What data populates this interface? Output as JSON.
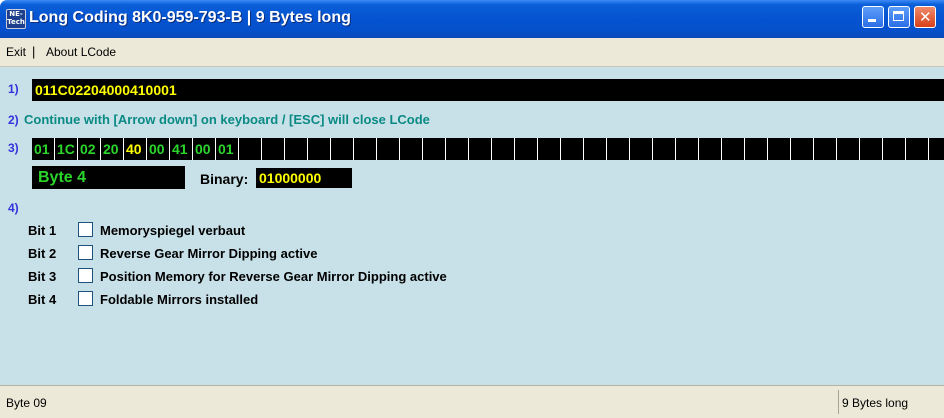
{
  "window": {
    "title": "Long Coding  8K0-959-793-B  |  9 Bytes long",
    "icon_text": [
      "NE-",
      "Tech"
    ]
  },
  "menu": {
    "items": [
      "Exit",
      "About LCode"
    ],
    "separator": "|"
  },
  "steps": {
    "s1": "1)",
    "s2": "2)",
    "s3": "3)",
    "s4": "4)"
  },
  "coding": {
    "value": "011C02204000410001"
  },
  "hint": "Continue with [Arrow down] on keyboard / [ESC] will close LCode",
  "bytes": {
    "values": [
      "01",
      "1C",
      "02",
      "20",
      "40",
      "00",
      "41",
      "00",
      "01"
    ],
    "selected_index": 4,
    "empty_cells": 31
  },
  "selected_byte": {
    "label": "Byte 4",
    "binary_label": "Binary:",
    "binary_value": "01000000"
  },
  "bits": [
    {
      "label": "Bit 1",
      "checked": false,
      "description": "Memoryspiegel verbaut"
    },
    {
      "label": "Bit 2",
      "checked": false,
      "description": "Reverse Gear Mirror Dipping active"
    },
    {
      "label": "Bit 3",
      "checked": false,
      "description": "Position Memory for Reverse Gear Mirror Dipping active"
    },
    {
      "label": "Bit 4",
      "checked": false,
      "description": "Foldable Mirrors installed"
    }
  ],
  "statusbar": {
    "left": "Byte 09",
    "right": "9 Bytes long"
  },
  "colors": {
    "title_blue": "#0553d1",
    "client_bg": "#c8e0e8",
    "value_yellow": "#ffff00",
    "value_green": "#2bd62b",
    "hint_teal": "#0a8a84",
    "step_blue": "#3333dd"
  }
}
